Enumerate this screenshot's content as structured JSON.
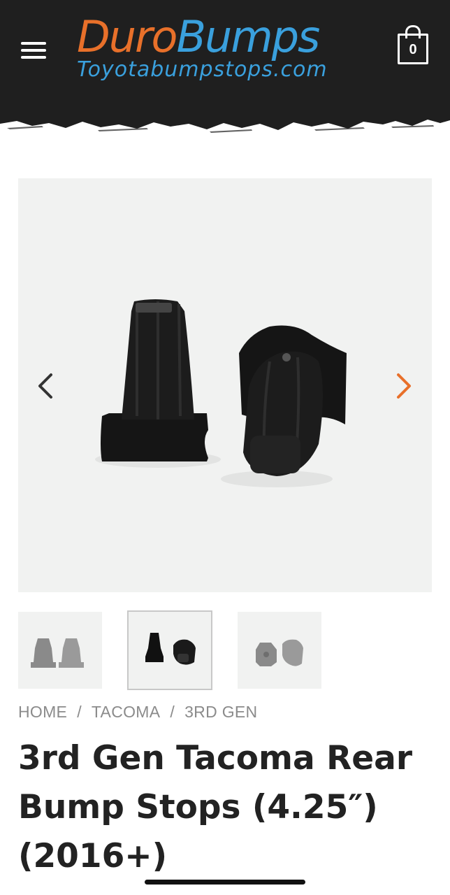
{
  "header": {
    "menu_icon": "hamburger-menu-icon",
    "logo": {
      "word1": "Duro",
      "word2": "Bumps",
      "subtitle": "Toyotabumpstops.com"
    },
    "cart": {
      "icon": "shopping-bag-icon",
      "count": "0"
    },
    "colors": {
      "background": "#1f1f1f",
      "logo_orange": "#e8702a",
      "logo_blue": "#3aa0dd"
    }
  },
  "gallery": {
    "prev_icon": "chevron-left-icon",
    "next_icon": "chevron-right-icon",
    "thumbnails": [
      {
        "name": "gray-bump-stops-upright",
        "selected": false
      },
      {
        "name": "black-bump-stops",
        "selected": true
      },
      {
        "name": "gray-bump-stops-side",
        "selected": false
      }
    ]
  },
  "breadcrumb": {
    "items": [
      "HOME",
      "TACOMA",
      "3RD GEN"
    ],
    "separator": "/"
  },
  "product": {
    "title": "3rd Gen Tacoma Rear Bump Stops (4.25″) (2016+)"
  }
}
